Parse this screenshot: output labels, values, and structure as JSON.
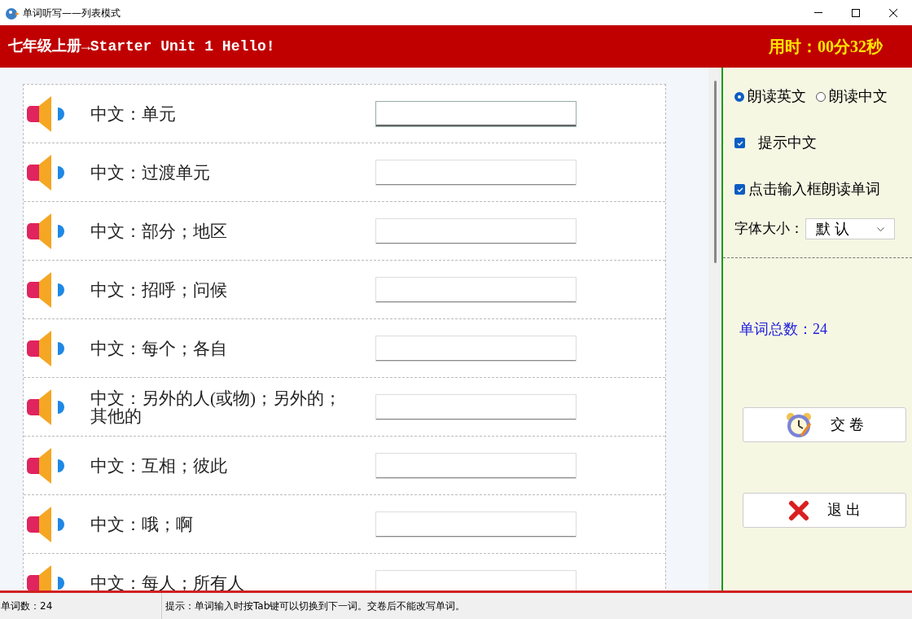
{
  "window": {
    "title": "单词听写——列表模式"
  },
  "header": {
    "title": "七年级上册→Starter Unit 1 Hello!",
    "timer": "用时：00分32秒"
  },
  "words": [
    {
      "hint": "中文：单元",
      "focused": true
    },
    {
      "hint": "中文：过渡单元",
      "focused": false
    },
    {
      "hint": "中文：部分；地区",
      "focused": false
    },
    {
      "hint": "中文：招呼；问候",
      "focused": false
    },
    {
      "hint": "中文：每个；各自",
      "focused": false
    },
    {
      "hint": "中文：另外的人(或物)；另外的；其他的",
      "focused": false
    },
    {
      "hint": "中文：互相；彼此",
      "focused": false
    },
    {
      "hint": "中文：哦；啊",
      "focused": false
    },
    {
      "hint": "中文：每人；所有人",
      "focused": false
    }
  ],
  "options": {
    "read_mode": [
      {
        "label": "朗读英文",
        "selected": true
      },
      {
        "label": "朗读中文",
        "selected": false
      }
    ],
    "checkboxes": [
      {
        "label": "提示中文",
        "checked": true
      },
      {
        "label": "点击输入框朗读单词",
        "checked": true
      }
    ],
    "font_size": {
      "label": "字体大小：",
      "value": "默 认"
    }
  },
  "word_total": "单词总数：24",
  "buttons": [
    {
      "kind": "submit",
      "label": "交 卷"
    },
    {
      "kind": "exit",
      "label": "退 出"
    }
  ],
  "status_bar": {
    "count": "单词数：24",
    "tip": "提示：单词输入时按Tab键可以切换到下一词。交卷后不能改写单词。"
  }
}
